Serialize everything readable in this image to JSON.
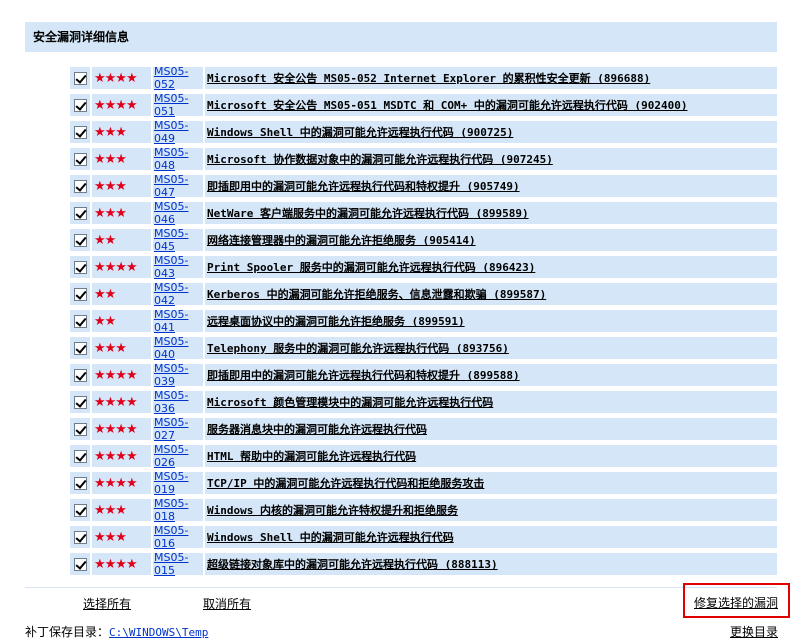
{
  "header": {
    "title": "安全漏洞详细信息"
  },
  "vulnerabilities": [
    {
      "id": "MS05-052",
      "stars": "★★★★",
      "title": "Microsoft 安全公告 MS05-052 Internet Explorer 的累积性安全更新 (896688)"
    },
    {
      "id": "MS05-051",
      "stars": "★★★★",
      "title": "Microsoft 安全公告 MS05-051 MSDTC 和 COM+ 中的漏洞可能允许远程执行代码 (902400)"
    },
    {
      "id": "MS05-049",
      "stars": "★★★",
      "title": "Windows Shell 中的漏洞可能允许远程执行代码 (900725)"
    },
    {
      "id": "MS05-048",
      "stars": "★★★",
      "title": "Microsoft 协作数据对象中的漏洞可能允许远程执行代码 (907245)"
    },
    {
      "id": "MS05-047",
      "stars": "★★★",
      "title": "即插即用中的漏洞可能允许远程执行代码和特权提升 (905749)"
    },
    {
      "id": "MS05-046",
      "stars": "★★★",
      "title": "NetWare 客户端服务中的漏洞可能允许远程执行代码 (899589)"
    },
    {
      "id": "MS05-045",
      "stars": "★★",
      "title": "网络连接管理器中的漏洞可能允许拒绝服务 (905414)"
    },
    {
      "id": "MS05-043",
      "stars": "★★★★",
      "title": "Print Spooler 服务中的漏洞可能允许远程执行代码 (896423)"
    },
    {
      "id": "MS05-042",
      "stars": "★★",
      "title": "Kerberos 中的漏洞可能允许拒绝服务、信息泄露和欺骗 (899587)"
    },
    {
      "id": "MS05-041",
      "stars": "★★",
      "title": "远程桌面协议中的漏洞可能允许拒绝服务 (899591)"
    },
    {
      "id": "MS05-040",
      "stars": "★★★",
      "title": "Telephony 服务中的漏洞可能允许远程执行代码 (893756)"
    },
    {
      "id": "MS05-039",
      "stars": "★★★★",
      "title": "即插即用中的漏洞可能允许远程执行代码和特权提升 (899588)"
    },
    {
      "id": "MS05-036",
      "stars": "★★★★",
      "title": "Microsoft 颜色管理模块中的漏洞可能允许远程执行代码"
    },
    {
      "id": "MS05-027",
      "stars": "★★★★",
      "title": "服务器消息块中的漏洞可能允许远程执行代码"
    },
    {
      "id": "MS05-026",
      "stars": "★★★★",
      "title": "HTML 帮助中的漏洞可能允许远程执行代码"
    },
    {
      "id": "MS05-019",
      "stars": "★★★★",
      "title": "TCP/IP 中的漏洞可能允许远程执行代码和拒绝服务攻击"
    },
    {
      "id": "MS05-018",
      "stars": "★★★",
      "title": "Windows 内核的漏洞可能允许特权提升和拒绝服务"
    },
    {
      "id": "MS05-016",
      "stars": "★★★",
      "title": "Windows Shell 中的漏洞可能允许远程执行代码"
    },
    {
      "id": "MS05-015",
      "stars": "★★★★",
      "title": "超级链接对象库中的漏洞可能允许远程执行代码 (888113)"
    }
  ],
  "footer": {
    "select_all": "选择所有",
    "deselect_all": "取消所有",
    "repair_selected": "修复选择的漏洞",
    "save_dir_label": "补丁保存目录：",
    "save_dir_path": "C:\\WINDOWS\\Temp",
    "change_dir": "更换目录"
  }
}
